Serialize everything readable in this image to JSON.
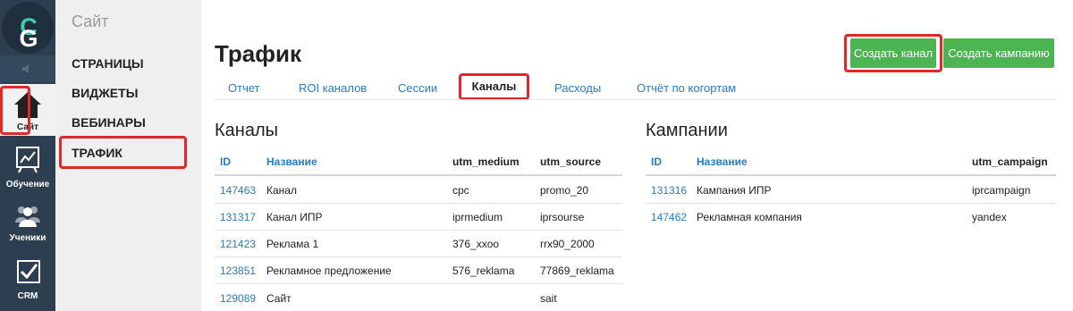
{
  "logo": {
    "g": "G",
    "c": "C"
  },
  "iconbar": {
    "items": [
      {
        "label": "Сайт"
      },
      {
        "label": "Обучение"
      },
      {
        "label": "Ученики"
      },
      {
        "label": "CRM"
      }
    ]
  },
  "subpanel": {
    "title": "Сайт",
    "items": [
      {
        "label": "СТРАНИЦЫ"
      },
      {
        "label": "ВИДЖЕТЫ"
      },
      {
        "label": "ВЕБИНАРЫ"
      },
      {
        "label": "ТРАФИК"
      }
    ]
  },
  "page": {
    "title": "Трафик",
    "create_channel": "Создать канал",
    "create_campaign": "Создать кампанию"
  },
  "tabs": [
    {
      "label": "Отчет"
    },
    {
      "label": "ROI каналов"
    },
    {
      "label": "Сессии"
    },
    {
      "label": "Каналы",
      "active": true
    },
    {
      "label": "Расходы"
    },
    {
      "label": "Отчёт по когортам"
    }
  ],
  "channels": {
    "title": "Каналы",
    "headers": [
      "ID",
      "Название",
      "utm_medium",
      "utm_source"
    ],
    "rows": [
      [
        "147463",
        "Канал",
        "cpc",
        "promo_20"
      ],
      [
        "131317",
        "Канал ИПР",
        "iprmedium",
        "iprsourse"
      ],
      [
        "121423",
        "Реклама 1",
        "376_xxoo",
        "rrx90_2000"
      ],
      [
        "123851",
        "Рекламное предложение",
        "576_reklama",
        "77869_reklama"
      ],
      [
        "129089",
        "Сайт",
        "",
        "sait"
      ]
    ]
  },
  "campaigns": {
    "title": "Кампании",
    "headers": [
      "ID",
      "Название",
      "utm_campaign"
    ],
    "rows": [
      [
        "131316",
        "Кампания ИПР",
        "iprcampaign"
      ],
      [
        "147462",
        "Рекламная компания",
        "yandex"
      ]
    ]
  },
  "colors": {
    "iconbar_bg": "#2d3e50",
    "accent_green": "#4cb552",
    "link_blue": "#2a7bbf",
    "highlight_red": "#e0282a"
  }
}
